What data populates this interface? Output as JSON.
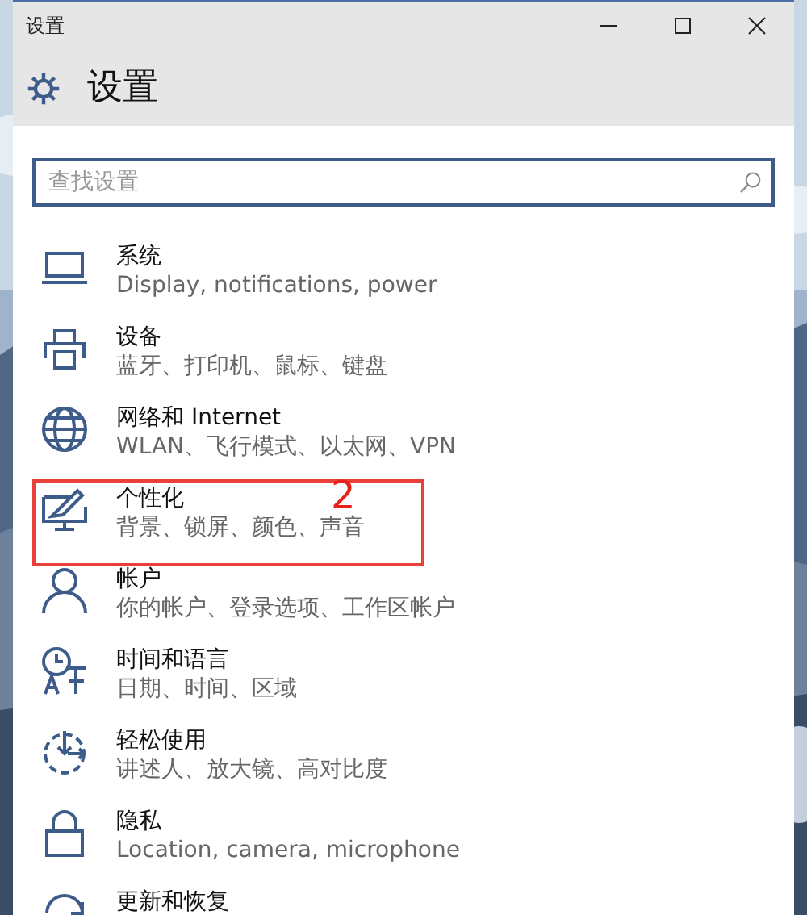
{
  "window": {
    "title": "设置"
  },
  "header": {
    "title": "设置"
  },
  "search": {
    "placeholder": "查找设置"
  },
  "items": [
    {
      "kind": "laptop",
      "title": "系统",
      "subtitle": "Display, notifications, power",
      "highlighted": false
    },
    {
      "kind": "printer",
      "title": "设备",
      "subtitle": "蓝牙、打印机、鼠标、键盘",
      "highlighted": false
    },
    {
      "kind": "globe",
      "title": "网络和 Internet",
      "subtitle": "WLAN、飞行模式、以太网、VPN",
      "highlighted": false
    },
    {
      "kind": "brush",
      "title": "个性化",
      "subtitle": "背景、锁屏、颜色、声音",
      "highlighted": true,
      "annotation": "2"
    },
    {
      "kind": "person",
      "title": "帐户",
      "subtitle": "你的帐户、登录选项、工作区帐户",
      "highlighted": false
    },
    {
      "kind": "clock",
      "title": "时间和语言",
      "subtitle": "日期、时间、区域",
      "highlighted": false
    },
    {
      "kind": "ease",
      "title": "轻松使用",
      "subtitle": "讲述人、放大镜、高对比度",
      "highlighted": false
    },
    {
      "kind": "lock",
      "title": "隐私",
      "subtitle": "Location, camera, microphone",
      "highlighted": false
    },
    {
      "kind": "update",
      "title": "更新和恢复",
      "highlighted": false
    }
  ]
}
